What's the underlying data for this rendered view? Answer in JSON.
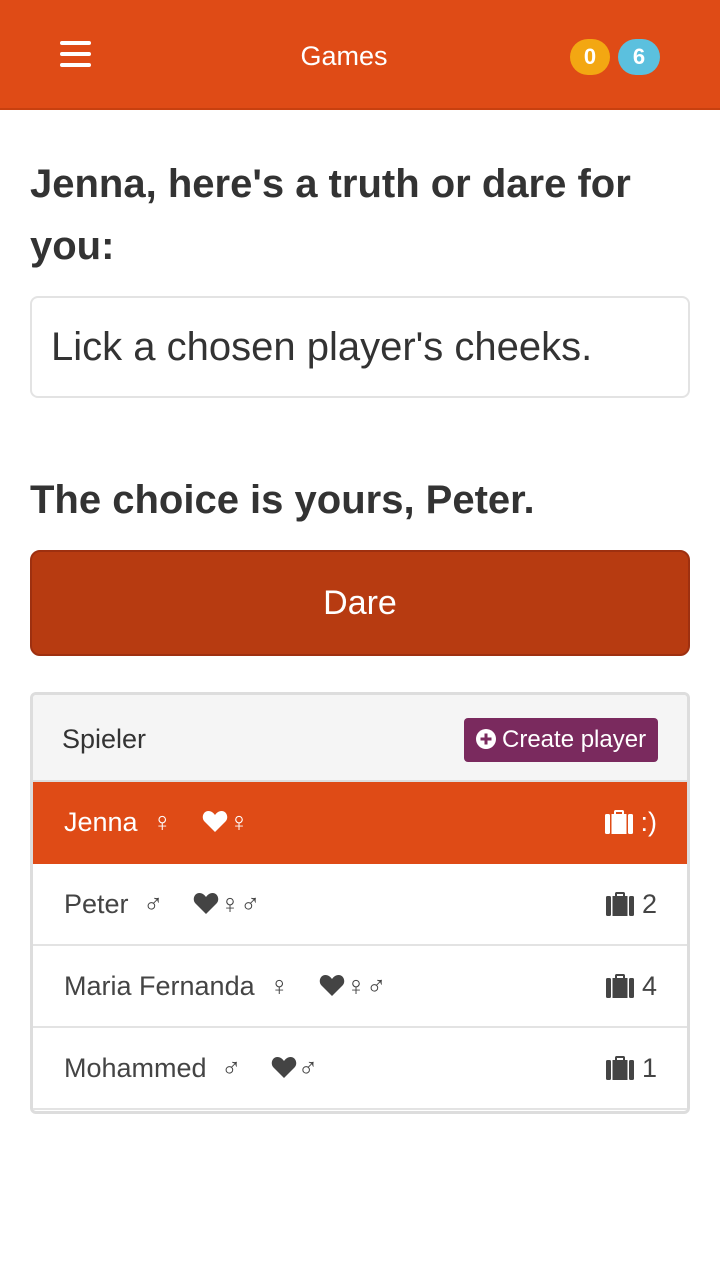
{
  "header": {
    "title": "Games",
    "badge_left": "0",
    "badge_right": "6",
    "color": "#df4b16"
  },
  "prompt_heading": "Jenna, here's a truth or dare for you:",
  "task_text": "Lick a chosen player's cheeks.",
  "choice_heading": "The choice is yours, Peter.",
  "dare_button": "Dare",
  "players_panel": {
    "title": "Spieler",
    "create_button": "Create player",
    "players": [
      {
        "name": "Jenna",
        "gender": "♀",
        "likes": "♀",
        "count": ":)",
        "active": true
      },
      {
        "name": "Peter",
        "gender": "♂",
        "likes": "♀♂",
        "count": "2",
        "active": false
      },
      {
        "name": "Maria Fernanda",
        "gender": "♀",
        "likes": "♀♂",
        "count": "4",
        "active": false
      },
      {
        "name": "Mohammed",
        "gender": "♂",
        "likes": "♂",
        "count": "1",
        "active": false
      }
    ]
  }
}
